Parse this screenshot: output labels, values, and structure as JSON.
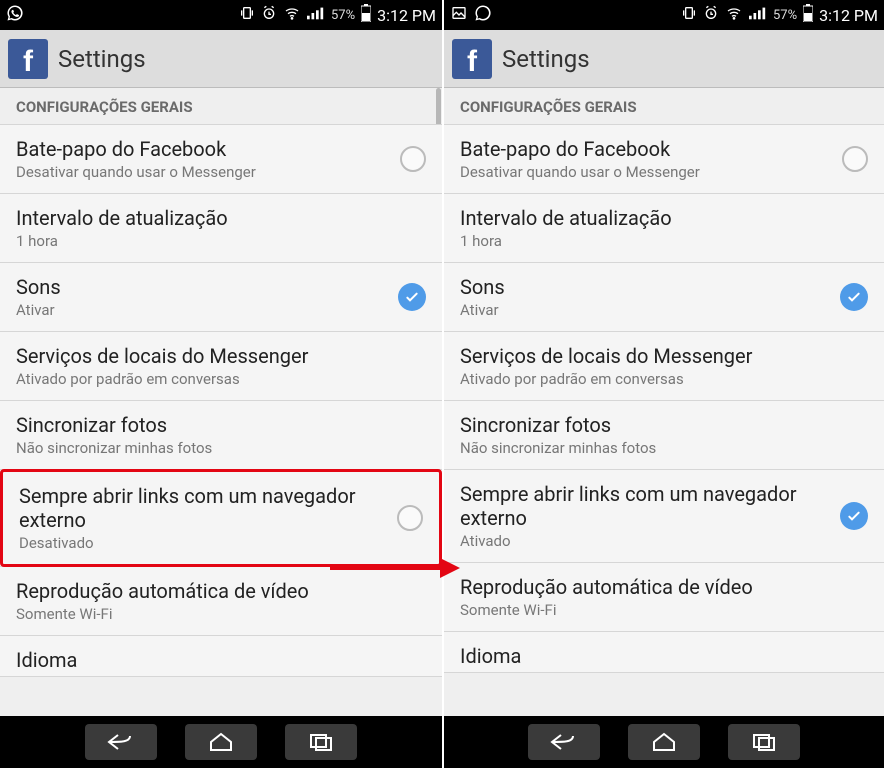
{
  "status": {
    "battery": "57%",
    "time": "3:12 PM"
  },
  "title": "Settings",
  "section": "CONFIGURAÇÕES GERAIS",
  "items": {
    "chat": {
      "title": "Bate-papo do Facebook",
      "sub": "Desativar quando usar o Messenger"
    },
    "refresh": {
      "title": "Intervalo de atualização",
      "sub": "1 hora"
    },
    "sounds": {
      "title": "Sons",
      "sub": "Ativar"
    },
    "loc": {
      "title": "Serviços de locais do Messenger",
      "sub": "Ativado por padrão em conversas"
    },
    "photos": {
      "title": "Sincronizar fotos",
      "sub": "Não sincronizar minhas fotos"
    },
    "links_off": {
      "title": "Sempre abrir links com um navegador externo",
      "sub": "Desativado"
    },
    "links_on": {
      "title": "Sempre abrir links com um navegador externo",
      "sub": "Ativado"
    },
    "video": {
      "title": "Reprodução automática de vídeo",
      "sub": "Somente Wi-Fi"
    },
    "lang": {
      "title": "Idioma"
    }
  }
}
